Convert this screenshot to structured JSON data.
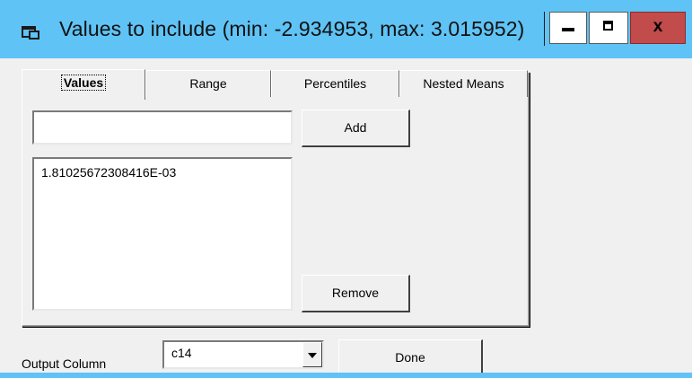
{
  "window": {
    "title": "Values to include (min: -2.934953, max: 3.015952)",
    "close_label": "x",
    "accent_color": "#5fc3f5",
    "close_color": "#c24b4b"
  },
  "tabs": [
    {
      "label": "Values",
      "active": true
    },
    {
      "label": "Range",
      "active": false
    },
    {
      "label": "Percentiles",
      "active": false
    },
    {
      "label": "Nested Means",
      "active": false
    }
  ],
  "values_tab": {
    "input_value": "",
    "add_label": "Add",
    "remove_label": "Remove",
    "list_items": [
      "1.81025672308416E-03"
    ]
  },
  "footer": {
    "output_label": "Output Column",
    "output_value": "c14",
    "done_label": "Done"
  },
  "icons": {
    "app": "window-app-icon",
    "minimize": "minimize-icon",
    "maximize": "maximize-icon",
    "close": "close-icon",
    "dropdown": "chevron-down-icon"
  }
}
